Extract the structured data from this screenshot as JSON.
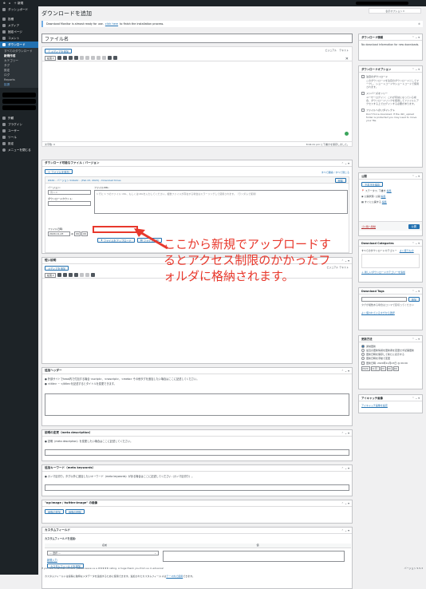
{
  "topbar": {
    "items": [
      "⊕",
      "⌂",
      "＋ 新規"
    ]
  },
  "sidebar": {
    "items": [
      {
        "label": "ダッシュボード",
        "active": false
      },
      {
        "label": "投稿"
      },
      {
        "label": "メディア"
      },
      {
        "label": "固定ページ"
      },
      {
        "label": "コメント"
      },
      {
        "label": "ダウンロード",
        "active": true
      }
    ],
    "sub": [
      "すべてのダウンロード",
      "新規作成",
      "カテゴリー",
      "タグ",
      "設定",
      "ログ",
      "Reports",
      "拡張"
    ],
    "items2": [
      "外観",
      "プラグイン",
      "ユーザー",
      "ツール",
      "設定",
      "メニューを閉じる"
    ]
  },
  "page": {
    "title": "ダウンロードを追加",
    "screen_options": "表示オプション ▾",
    "notice": {
      "pre": "Download Monitor is almost ready for use.",
      "link": "click here",
      "post": "to finish the installation process.",
      "close": "⊗"
    }
  },
  "post_title": {
    "value": "ファイル名"
  },
  "editor": {
    "add_media": "メディアを追加",
    "tabs": "ビジュアル　テキスト",
    "format": "段落 ▾",
    "word_count": "文字数: 0",
    "saved": "8:04:41 pm に下書きを保存しました。"
  },
  "downloads_box": {
    "title": "ダウンロード可能なファイル / バージョン",
    "add_file": "＋ ファイルを追加",
    "expand": "すべて展開 / すべて閉じる",
    "version_header": "#449 – バージョン 0x9a9c – (Feb 23, 2020) – Download times",
    "remove": "削除",
    "version_label": "バージョン:",
    "version_placeholder": "例:1.0",
    "count_label": "ダウンロードカウント:",
    "url_label": "ファイルURL:",
    "url_placeholder": "1 行に 1 つのファイル URL、もしくはURLを入力してください。複数ファイルが存在する場合はミラーリングして使用されます。（ランダムで使用）",
    "date_label": "ファイル日時:",
    "date_value": "2020-11-23",
    "hour": "09",
    "min": "09",
    "at": "@",
    "upload_btn": "ファイルをアップロード",
    "browse_btn": "ファイル参照"
  },
  "short_desc": {
    "title": "短い説明",
    "add_media": "メディアを追加",
    "tabs": "ビジュアル テキスト"
  },
  "redirect_header": {
    "title": "追加ヘッダー",
    "text1": "● 外部サイトでhead内で付加する場合 <script>、<noscript>、<meta> その他タグを追加したい場合はここに記述してください。",
    "text2": "● <title> ~ </title>を記述するとタイトルを変更できます。"
  },
  "meta_desc": {
    "title": "説明の変更（meta description）",
    "text": "● 説明（meta description）を変更したい場合はここに記述してください。"
  },
  "meta_kw": {
    "title": "追加キーワード（meta keywords）",
    "text": "● カンマ区切り。タグ以外に追加したいキーワード（meta keywords）がある場合はここに記述してください（カンマ区切り）。"
  },
  "og_box": {
    "title": "\"og:image / twitter:image\" の画像",
    "btn1": "画像の追加",
    "btn2": "画像の削除"
  },
  "custom_fields": {
    "title": "カスタムフィールド",
    "add_new": "カスタムフィールドを追加:",
    "col_name": "名前",
    "col_value": "値",
    "select": "— 選択 —",
    "enter_new": "新規入力",
    "add_btn": "カスタムフィールドを追加",
    "help": "カスタムフィールドは投稿に独特なメタデータを追加するために使用できます。追加されたカスタムフィールドは",
    "help_link": "テーマ内で使用",
    "help_tail": "できます。"
  },
  "right": {
    "dl_info": {
      "title": "ダウンロード情報",
      "text": "No download information for new downloads."
    },
    "dl_options": {
      "title": "ダウンロードオプション",
      "opts": [
        "注目のダウンロード",
        "このダウンロードを注目のダウンロードとしてマークし、ショートコードやショートコードで使用されます。",
        "メンバーズオンリー",
        "ユーザーログイン：これが有効になっている場合、ダウンロードリンクを使用してファイルにアクセスする上でログインする必要があります。",
        "ファイルへのリダイレクト",
        "Don't force download. If the dlm_upload folder is protected you may need to move your file."
      ]
    },
    "publish": {
      "title": "公開",
      "save_draft": "下書きを保存",
      "status": "ステータス: 下書き",
      "status_edit": "編集",
      "visibility": "公開状態: 公開",
      "vis_edit": "編集",
      "date": "すぐに公開する",
      "date_edit": "編集",
      "trash": "ゴミ箱へ移動",
      "publish_btn": "公開"
    },
    "categories": {
      "title": "Download Categories",
      "tab1": "すべてのダウンロードカテゴリー",
      "tab2": "よく使うもの",
      "add_new": "＋ 新しいダウンロードカテゴリーを追加"
    },
    "tags": {
      "title": "Download Tags",
      "add_btn": "追加",
      "hint": "タグが複数ある場合はコンマで区切ってください",
      "choose": "よく使われているタグから選択"
    },
    "update": {
      "title": "更新方法",
      "options": [
        "通常更新",
        "最近の更新情報を更新者を変更せず記事更新",
        "更新日時を保存して新たに表示する",
        "更新日時を手動で変更"
      ],
      "label": "更新日時: 2020年11月23日 @ 09:09",
      "y": "2020",
      "m": "11月",
      "d": "23",
      "h": "09",
      "mi": "09"
    },
    "eyecatch": {
      "title": "アイキャッチ画像",
      "link": "アイキャッチ画像を設定"
    }
  },
  "annotation": {
    "text": "ここから新規でアップロードするとアクセス制限のかかったフォルダに格納されます。"
  },
  "footer": {
    "left": "If you like Download Monitor please leave us a ★★★★★ rating. A huge thank you from us in advance!",
    "right": "バージョン 5.5.3"
  }
}
